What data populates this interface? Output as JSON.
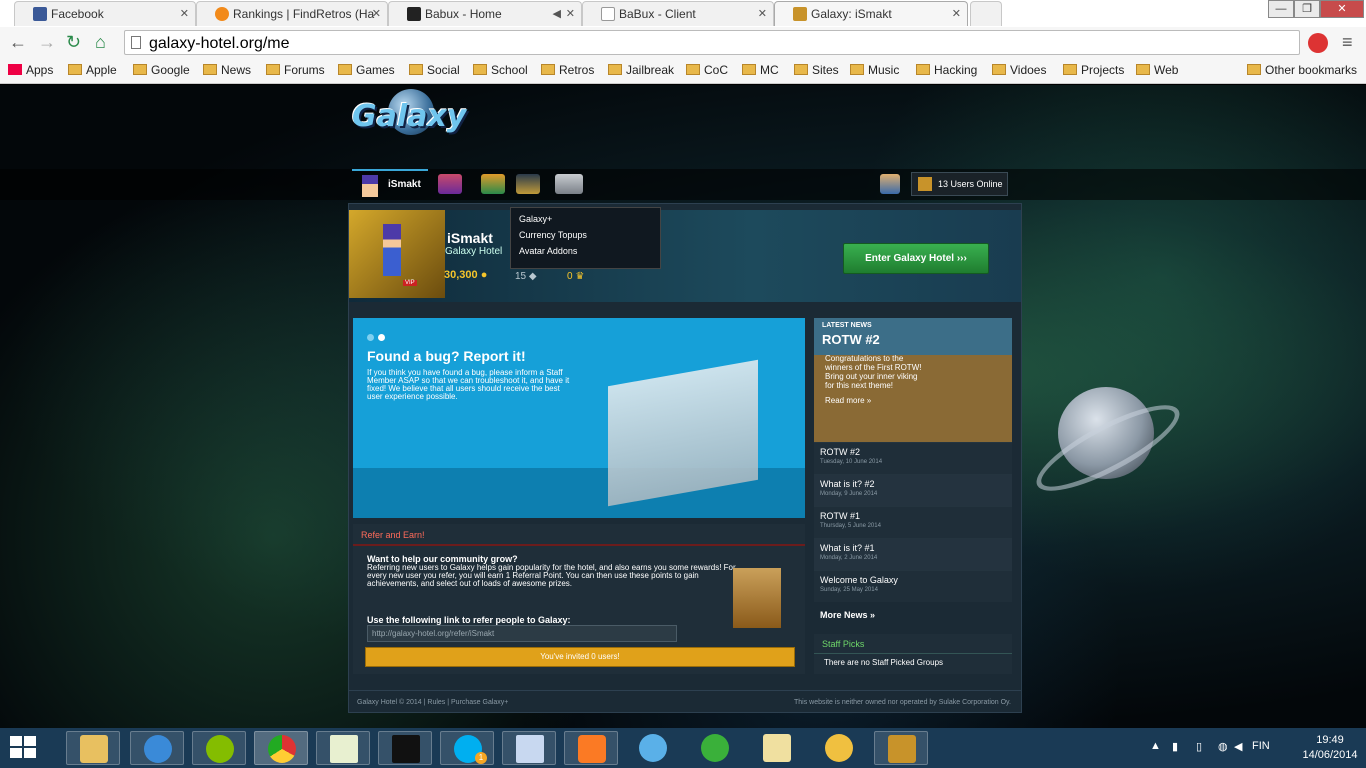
{
  "browser": {
    "tabs": [
      {
        "title": "Facebook",
        "icon": "facebook-icon",
        "color": "#3b5998"
      },
      {
        "title": "Rankings | FindRetros (Ha",
        "icon": "flame-icon",
        "color": "#f28a1a"
      },
      {
        "title": "Babux - Home",
        "icon": "b-icon",
        "color": "#222222"
      },
      {
        "title": "BaBux - Client",
        "icon": "page-icon",
        "color": "#ffffff"
      },
      {
        "title": "Galaxy: iSmakt",
        "icon": "box-icon",
        "color": "#c8932a"
      }
    ],
    "url": "galaxy-hotel.org/me",
    "bookmarks": [
      "Apps",
      "Apple",
      "Google",
      "News",
      "Forums",
      "Games",
      "Social",
      "School",
      "Retros",
      "Jailbreak",
      "CoC",
      "MC",
      "Sites",
      "Music",
      "Hacking",
      "Vidoes",
      "Projects",
      "Web"
    ],
    "other_bookmarks": "Other bookmarks"
  },
  "site": {
    "logo": "Galaxy",
    "username_tab": "iSmakt",
    "online": "13 Users Online",
    "dropdown": [
      "Galaxy+",
      "Currency Topups",
      "Avatar Addons"
    ]
  },
  "hero": {
    "username": "iSmakt",
    "hotel": "Galaxy Hotel",
    "coins": "30,300",
    "pixels": "15",
    "diamonds": "0",
    "enter_button": "Enter Galaxy Hotel ›››"
  },
  "bug": {
    "title": "Found a bug? Report it!",
    "text": "If you think you have found a bug, please inform a Staff Member ASAP so that we can troubleshoot it, and have it fixed! We believe that all users should receive the best user experience possible."
  },
  "news": {
    "label": "LATEST NEWS",
    "title": "ROTW #2",
    "text": "Congratulations to the winners of the First ROTW! Bring out your inner viking for this next theme!",
    "read_more": "Read more »",
    "items": [
      {
        "title": "ROTW #2",
        "date": "Tuesday, 10 June 2014"
      },
      {
        "title": "What is it? #2",
        "date": "Monday, 9 June 2014"
      },
      {
        "title": "ROTW #1",
        "date": "Thursday, 5 June 2014"
      },
      {
        "title": "What is it? #1",
        "date": "Monday, 2 June 2014"
      },
      {
        "title": "Welcome to Galaxy",
        "date": "Sunday, 25 May 2014"
      }
    ],
    "more": "More News »"
  },
  "staff": {
    "heading": "Staff Picks",
    "body": "There are no Staff Picked Groups"
  },
  "refer": {
    "heading": "Refer and Earn!",
    "title": "Want to help our community grow?",
    "text": "Referring new users to Galaxy helps gain popularity for the hotel, and also earns you some rewards! For every new user you refer, you will earn 1 Referral Point. You can then use these points to gain achievements, and select out of loads of awesome prizes.",
    "link_label": "Use the following link to refer people to Galaxy:",
    "link": "http://galaxy-hotel.org/refer/iSmakt",
    "invited": "You've invited 0 users!"
  },
  "footer": {
    "left": "Galaxy Hotel © 2014 | Rules | Purchase Galaxy+",
    "right": "This website is neither owned nor operated by Sulake Corporation Oy."
  },
  "taskbar": {
    "language": "FIN",
    "time": "19:49",
    "date": "14/06/2014",
    "skype_badge": "1"
  }
}
